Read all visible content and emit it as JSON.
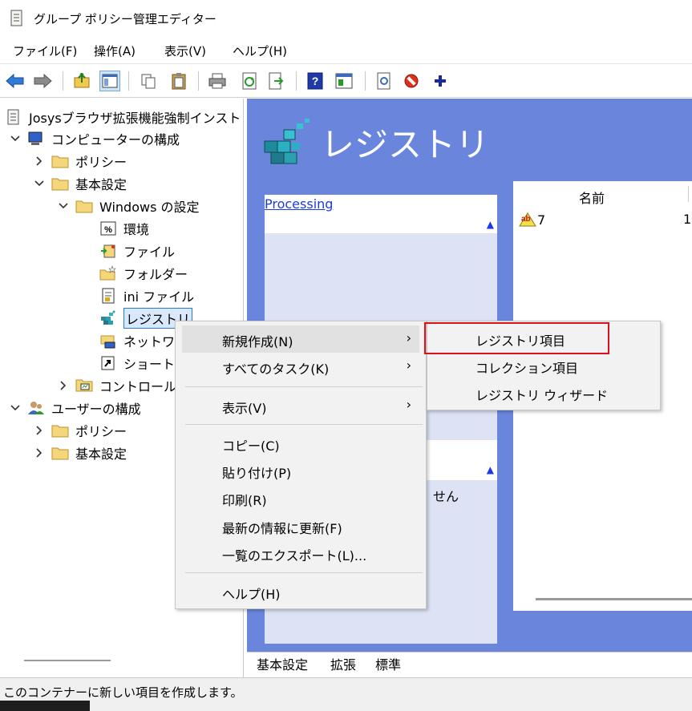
{
  "window": {
    "title": "グループ ポリシー管理エディター"
  },
  "menubar": {
    "items": [
      "ファイル(F)",
      "操作(A)",
      "表示(V)",
      "ヘルプ(H)"
    ]
  },
  "toolbar": {
    "buttons": [
      "back-icon",
      "forward-icon",
      "up-folder-icon",
      "show-hide-tree-icon",
      "copy-icon",
      "paste-icon",
      "print-icon",
      "refresh-icon",
      "export-icon",
      "help-icon",
      "properties-icon",
      "filter-icon",
      "delete-icon",
      "add-icon"
    ]
  },
  "tree": {
    "root": "Josysブラウザ拡張機能強制インスト",
    "computer_config": "コンピューターの構成",
    "policy": "ポリシー",
    "basic_settings": "基本設定",
    "windows_settings": "Windows の設定",
    "environment": "環境",
    "files": "ファイル",
    "folders": "フォルダー",
    "ini_files": "ini ファイル",
    "registry": "レジストリ",
    "network": "ネットワー",
    "shortcuts": "ショートカ",
    "control_panel": "コントロール",
    "user_config": "ユーザーの構成",
    "user_policy": "ポリシー",
    "user_basic_settings": "基本設定"
  },
  "right_pane": {
    "heading": "レジストリ",
    "processing_link": "Processing",
    "desc_snippet": "せん",
    "list": {
      "column_name": "名前",
      "rows": [
        {
          "name": "7",
          "value2": "1"
        }
      ]
    }
  },
  "tabs": [
    "基本設定",
    "拡張",
    "標準"
  ],
  "statusbar": {
    "text": "このコンテナーに新しい項目を作成します。"
  },
  "context_menu": {
    "items": [
      {
        "label": "新規作成(N)",
        "has_submenu": true
      },
      {
        "label": "すべてのタスク(K)",
        "has_submenu": true
      },
      {
        "label": "表示(V)",
        "has_submenu": true
      },
      {
        "label": "コピー(C)",
        "has_submenu": false
      },
      {
        "label": "貼り付け(P)",
        "has_submenu": false
      },
      {
        "label": "印刷(R)",
        "has_submenu": false
      },
      {
        "label": "最新の情報に更新(F)",
        "has_submenu": false
      },
      {
        "label": "一覧のエクスポート(L)...",
        "has_submenu": false
      },
      {
        "label": "ヘルプ(H)",
        "has_submenu": false
      }
    ]
  },
  "submenu": {
    "items": [
      "レジストリ項目",
      "コレクション項目",
      "レジストリ ウィザード"
    ]
  },
  "colors": {
    "right_pane_bg": "#6a86dc",
    "highlight_box": "#e0101a",
    "link": "#1a3be0"
  }
}
